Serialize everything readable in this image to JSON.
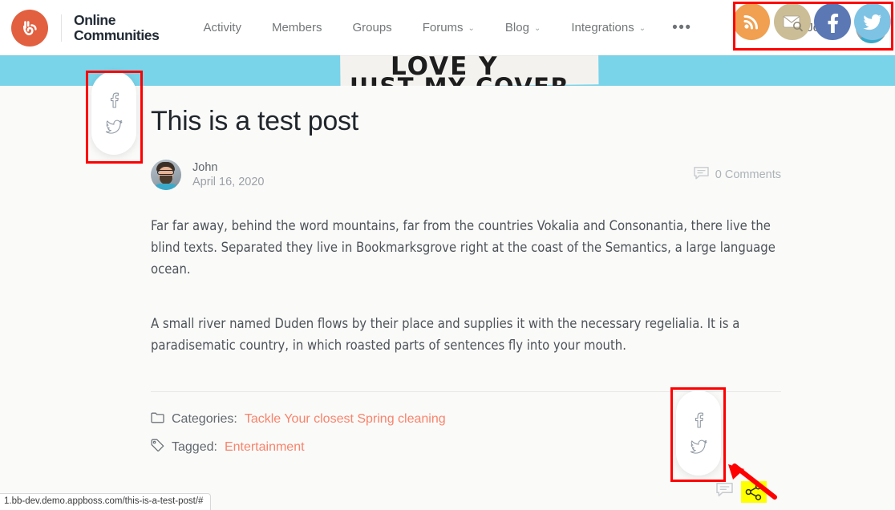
{
  "header": {
    "brand": {
      "line1": "Online",
      "line2": "Communities",
      "logo_icon": "buddyboss-logo-icon",
      "logo_color": "#e2603f"
    },
    "nav": [
      {
        "label": "Activity",
        "has_caret": false
      },
      {
        "label": "Members",
        "has_caret": false
      },
      {
        "label": "Groups",
        "has_caret": false
      },
      {
        "label": "Forums",
        "has_caret": true
      },
      {
        "label": "Blog",
        "has_caret": true
      },
      {
        "label": "Integrations",
        "has_caret": true
      }
    ],
    "more_label": "•••",
    "user": {
      "name": "John",
      "caret": "⌄",
      "avatar_icon": "user-avatar"
    },
    "social_icons": [
      {
        "name": "rss-icon",
        "label": "RSS",
        "color": "#f0a050"
      },
      {
        "name": "email-search-icon",
        "label": "Email",
        "color": "#cbbd96"
      },
      {
        "name": "facebook-icon",
        "label": "Facebook",
        "color": "#5b78b5"
      },
      {
        "name": "twitter-icon",
        "label": "Twitter",
        "color": "#7fc3e4"
      }
    ]
  },
  "cover": {
    "background_color": "#79d3e9",
    "text_line1": "LOVE Y",
    "text_line2": "JUST MY COVER."
  },
  "share_widgets": {
    "icons": [
      {
        "name": "facebook-share-icon",
        "label": "Facebook"
      },
      {
        "name": "twitter-share-icon",
        "label": "Twitter"
      }
    ]
  },
  "post": {
    "title": "This is a test post",
    "author": "John",
    "date": "April 16, 2020",
    "comments_label": "0 Comments",
    "paragraph1": "Far far away, behind the word mountains, far from the countries Vokalia and Consonantia, there live the blind texts. Separated they live in Bookmarksgrove right at the coast of the Semantics, a large language ocean.",
    "paragraph2": "A small river named Duden flows by their place and supplies it with the necessary regelialia. It is a paradisematic country, in which roasted parts of sentences fly into your mouth.",
    "categories_label": "Categories:",
    "categories_value": "Tackle Your closest Spring cleaning",
    "tagged_label": "Tagged:",
    "tagged_value": "Entertainment",
    "link_color": "#f9836a"
  },
  "bottom_bar": {
    "comment_icon": "comment-icon",
    "share_icon": "share-nodes-icon",
    "highlight_color": "#ffff00"
  },
  "annotations": {
    "box_color": "#ff0000",
    "arrow_color": "#ff0000"
  },
  "statusbar": {
    "url": "1.bb-dev.demo.appboss.com/this-is-a-test-post/#"
  }
}
